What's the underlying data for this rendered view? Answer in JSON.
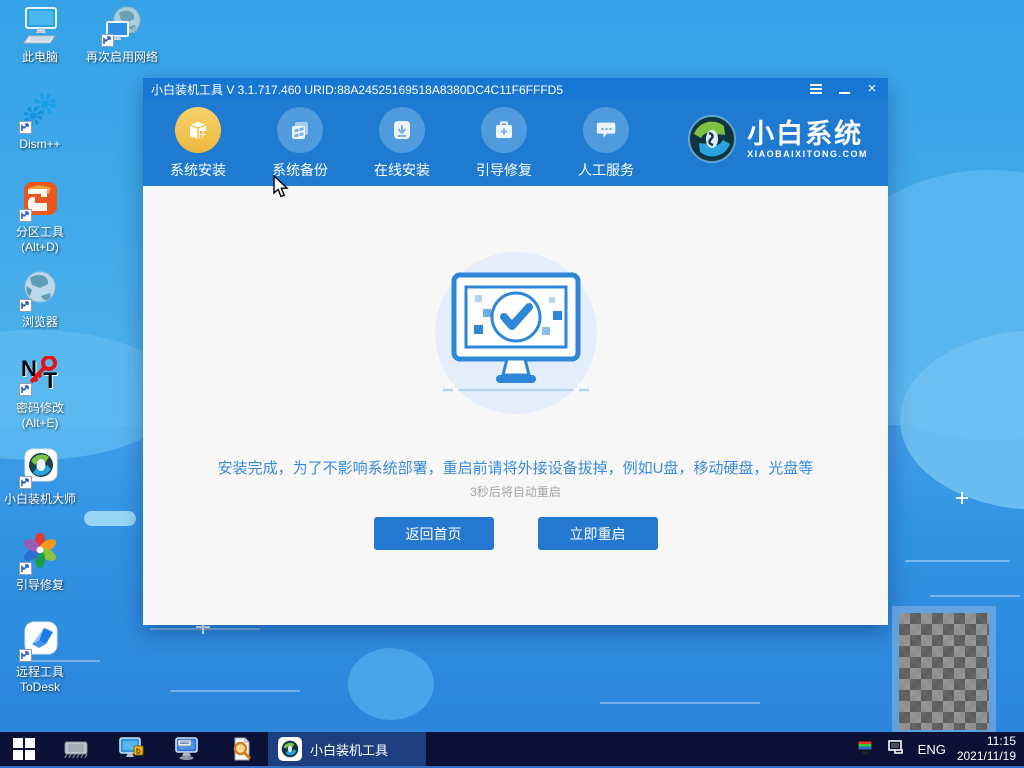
{
  "colors": {
    "titlebar_blue": "#1877d2",
    "nav_blue": "#1f7bd2",
    "accent_blue": "#2478d0",
    "active_tab_yellow": "#ecb93e",
    "content_bg": "#f7f7f8",
    "message_blue": "#3a8bdc",
    "taskbar_navy": "#0a1134",
    "active_task_blue": "#1d3f80"
  },
  "desktop": {
    "icons": [
      {
        "label": "此电脑"
      },
      {
        "label": "再次启用网络"
      },
      {
        "label": "Dism++"
      },
      {
        "label": "分区工具",
        "label2": "(Alt+D)"
      },
      {
        "label": "浏览器"
      },
      {
        "label": "密码修改",
        "label2": "(Alt+E)",
        "icon_n": "N",
        "icon_t": "T"
      },
      {
        "label": "小白装机大师"
      },
      {
        "label": "引导修复"
      },
      {
        "label": "远程工具",
        "label2": "ToDesk"
      }
    ]
  },
  "window": {
    "title": "小白装机工具 V 3.1.717.460 URID:88A24525169518A8380DC4C11F6FFFD5",
    "controls": {
      "close": "×"
    },
    "nav": [
      {
        "label": "系统安装"
      },
      {
        "label": "系统备份"
      },
      {
        "label": "在线安装"
      },
      {
        "label": "引导修复"
      },
      {
        "label": "人工服务"
      }
    ],
    "logo": {
      "title": "小白系统",
      "subtitle": "XIAOBAIXITONG.COM"
    },
    "main": {
      "message": "安装完成，为了不影响系统部署，重启前请将外接设备拔掉，例如U盘，移动硬盘，光盘等",
      "countdown": "3秒后将自动重启",
      "home_button": "返回首页",
      "restart_button": "立即重启"
    }
  },
  "taskbar": {
    "active_task": "小白装机工具",
    "tray": {
      "language": "ENG",
      "time": "11:15",
      "date": "2021/11/19"
    }
  }
}
